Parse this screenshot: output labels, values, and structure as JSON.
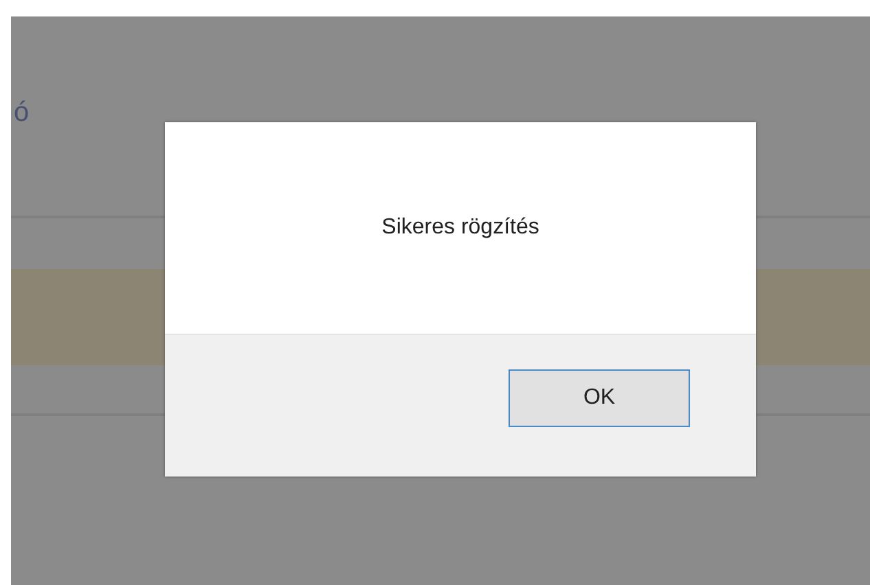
{
  "background": {
    "label_fragment": "ó"
  },
  "dialog": {
    "message": "Sikeres rögzítés",
    "buttons": [
      "OK"
    ]
  }
}
